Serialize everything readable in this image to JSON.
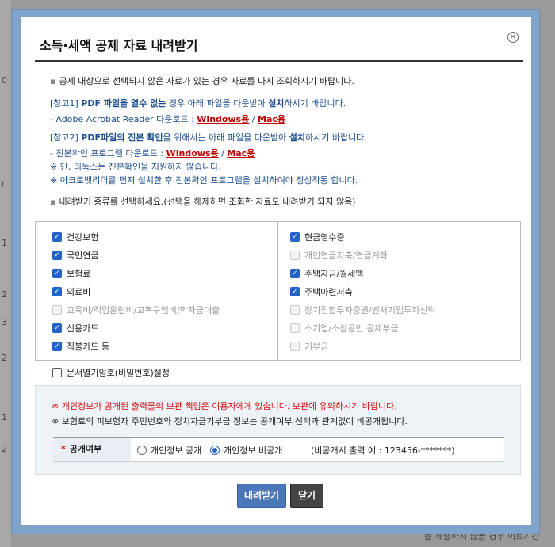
{
  "background": {
    "left_marks": [
      "0",
      "r",
      "1",
      "2",
      "3",
      "2",
      "1",
      "2"
    ],
    "bottom_text": "를 제출하지 않을 경우 이르기간"
  },
  "dialog": {
    "title": "소득·세액 공제 자료 내려받기",
    "close_icon": "×"
  },
  "notices": {
    "line1": "공제 대상으로 선택되지 않은 자료가 있는 경우 자료를 다시 조회하시기 바랍니다.",
    "ref1": {
      "prefix": "[참고1] ",
      "bold1": "PDF 파일을 열수 없는",
      "mid": " 경우  아래 파일을 다운받아 ",
      "bold2": "설치",
      "suffix": "하시기 바랍니다.",
      "acrobat_prefix": "- Adobe Acrobat Reader 다운로드 : ",
      "windows": "Windows용",
      "slash": " / ",
      "mac": "Mac용"
    },
    "ref2": {
      "prefix": "[참고2] ",
      "bold1": "PDF파일의 진본 확인",
      "mid": "을 위해서는 아래 파일을 다운받아 ",
      "bold2": "설치",
      "suffix": "하시기 바랍니다.",
      "verify_prefix": "- 진본확인 프로그램 다운로드 : ",
      "windows": "Windows용",
      "slash": " / ",
      "mac": "Mac용",
      "note1": "※ 단, 리눅스는 진본확인을 지원하지 않습니다.",
      "note2": "※ 아크로벳리더를 먼저 설치한 후 진본확인 프로그램을 설치하여야 정상작동 합니다."
    },
    "select_instruction": "내려받기 종류를 선택하세요.(선택을 해제하면 조회한 자료도 내려받기 되지 않음)"
  },
  "checkboxes": {
    "left": [
      {
        "label": "건강보험",
        "checked": true,
        "disabled": false
      },
      {
        "label": "국민연금",
        "checked": true,
        "disabled": false
      },
      {
        "label": "보험료",
        "checked": true,
        "disabled": false
      },
      {
        "label": "의료비",
        "checked": true,
        "disabled": false
      },
      {
        "label": "교육비/직업훈련비/교복구입비/학자금대출",
        "checked": false,
        "disabled": true
      },
      {
        "label": "신용카드",
        "checked": true,
        "disabled": false
      },
      {
        "label": "직불카드 등",
        "checked": true,
        "disabled": false
      }
    ],
    "right": [
      {
        "label": "현금영수증",
        "checked": true,
        "disabled": false
      },
      {
        "label": "개인연금저축/연금계좌",
        "checked": false,
        "disabled": true
      },
      {
        "label": "주택자금/월세액",
        "checked": true,
        "disabled": false
      },
      {
        "label": "주택마련저축",
        "checked": true,
        "disabled": false
      },
      {
        "label": "장기집합투자증권/벤처기업투자신탁",
        "checked": false,
        "disabled": true
      },
      {
        "label": "소기업/소상공인 공제부금",
        "checked": false,
        "disabled": true
      },
      {
        "label": "기부금",
        "checked": false,
        "disabled": true
      }
    ],
    "password_setting": {
      "label": "문서열기암호(비밀번호)설정",
      "checked": false
    }
  },
  "privacy": {
    "warning": "※ 개인정보가 공개된 출력물의 보관 책임은 이용자에게 있습니다. 보관에 유의하시기 바랍니다.",
    "notice": "※ 보험료의 피보험자 주민번호와 정치자금기부금 정보는 공개여부 선택과 관계없이 비공개됩니다.",
    "option_label_star": "*",
    "option_label": "공개여부",
    "radio_public": "개인정보 공개",
    "radio_private": "개인정보 비공개",
    "selected": "private",
    "example": "(비공개시 출력 예 : 123456-*******)"
  },
  "buttons": {
    "download": "내려받기",
    "close": "닫기"
  },
  "colors": {
    "primary_button": "#4a77b5",
    "close_button": "#444444",
    "checkbox_checked": "#2463c6",
    "link_red": "#c00000",
    "notice_blue": "#1c4d8c"
  }
}
